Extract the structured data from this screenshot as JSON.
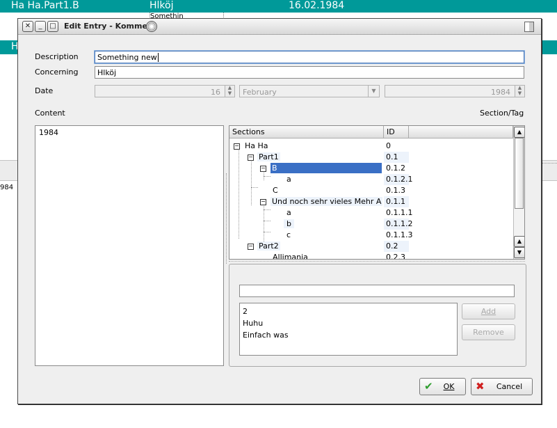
{
  "background": {
    "row1": {
      "col1": "Ha Ha.Part1.B",
      "col2": "Hlköj",
      "col3": "16.02.1984"
    },
    "cell_text": "Somethin",
    "row2_text": "H",
    "side_text": "984"
  },
  "dialog": {
    "title": "Edit Entry - Komment",
    "labels": {
      "description": "Description",
      "concerning": "Concerning",
      "date": "Date",
      "content": "Content",
      "section_tag": "Section/Tag"
    },
    "fields": {
      "description": "Something new",
      "concerning": "Hlköj",
      "day": "16",
      "month": "February",
      "year": "1984"
    },
    "content_text": "1984",
    "tree": {
      "headers": {
        "sections": "Sections",
        "id": "ID"
      },
      "rows": [
        {
          "name": "Ha Ha",
          "id": "0"
        },
        {
          "name": "Part1",
          "id": "0.1"
        },
        {
          "name": "B",
          "id": "0.1.2"
        },
        {
          "name": "a",
          "id": "0.1.2.1"
        },
        {
          "name": "C",
          "id": "0.1.3"
        },
        {
          "name": "Und noch sehr vieles Mehr A",
          "id": "0.1.1"
        },
        {
          "name": "a",
          "id": "0.1.1.1"
        },
        {
          "name": "b",
          "id": "0.1.1.2"
        },
        {
          "name": "c",
          "id": "0.1.1.3"
        },
        {
          "name": "Part2",
          "id": "0.2"
        },
        {
          "name": "Allimania",
          "id": "0.2.3"
        }
      ]
    },
    "tag_input": "",
    "tag_list": [
      "2",
      "Huhu",
      "Einfach was"
    ],
    "buttons": {
      "add": "Add",
      "remove": "Remove",
      "ok": "OK",
      "cancel": "Cancel"
    },
    "colors": {
      "selection": "#3a6fc5",
      "teal": "#009999"
    }
  }
}
